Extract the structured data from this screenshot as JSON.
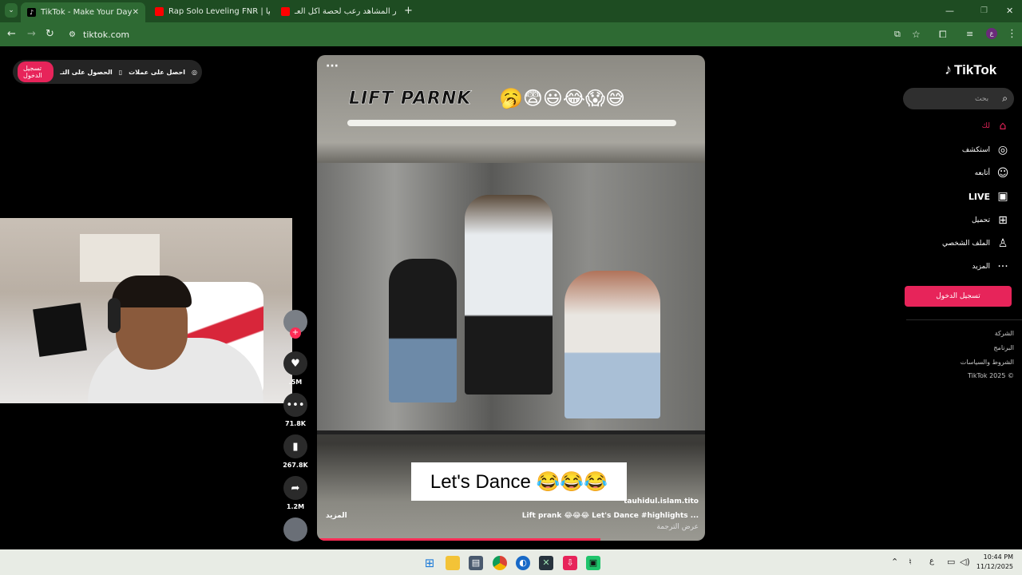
{
  "browser": {
    "tabs": [
      {
        "title": "TikTok - Make Your Day",
        "active": true
      },
      {
        "title": "Rap Solo Leveling FNR | تيقليقيا",
        "active": false
      },
      {
        "title": "اكثر المشاهد رعب لحصة اكل العـ",
        "active": false
      }
    ],
    "url": "tiktok.com",
    "new_tab": "+"
  },
  "promo": {
    "get_coins": "احصل على عملات",
    "get_app": "الحصول على التـ",
    "login": "تسجيل الدخول"
  },
  "video": {
    "title": "LIFT PARNK",
    "title_emoji": "🥱😨😃😂😱😅",
    "caption_overlay": "Let's Dance 😂😂😂",
    "author": "tauhidul.islam.tito",
    "description": "Lift prank 😂😂😂 Let's Dance #highlights ...",
    "more": "المزيد",
    "translate": "عرض الترجمة",
    "menu": "···",
    "progress": 0.73
  },
  "actions": {
    "likes": ".5M",
    "comments": "71.8K",
    "saves": "267.8K",
    "shares": "1.2M"
  },
  "sidebar": {
    "logo": "TikTok",
    "search_placeholder": "بحث",
    "nav": [
      {
        "label": "لك",
        "icon": "home-icon",
        "glyph": "⌂",
        "active": true
      },
      {
        "label": "استكشف",
        "icon": "compass-icon",
        "glyph": "◎"
      },
      {
        "label": "أتابعه",
        "icon": "following-icon",
        "glyph": "☺"
      },
      {
        "label": "LIVE",
        "icon": "live-icon",
        "glyph": "▣"
      },
      {
        "label": "تحميل",
        "icon": "upload-icon",
        "glyph": "⊞"
      },
      {
        "label": "الملف الشخصي",
        "icon": "profile-icon",
        "glyph": "♙"
      },
      {
        "label": "المزيد",
        "icon": "more-icon",
        "glyph": "···"
      }
    ],
    "login_button": "تسجيل الدخول",
    "footer": [
      "الشركة",
      "البرنامج",
      "الشروط والسياسات",
      "TikTok 2025 ©"
    ]
  },
  "taskbar": {
    "time": "10:44 PM",
    "date": "11/12/2025",
    "lang": "ع"
  },
  "colors": {
    "tabbar": "#1e4c22",
    "toolbar": "#2e6a33",
    "accent": "#e7245a",
    "progress": "#fe2c55"
  }
}
